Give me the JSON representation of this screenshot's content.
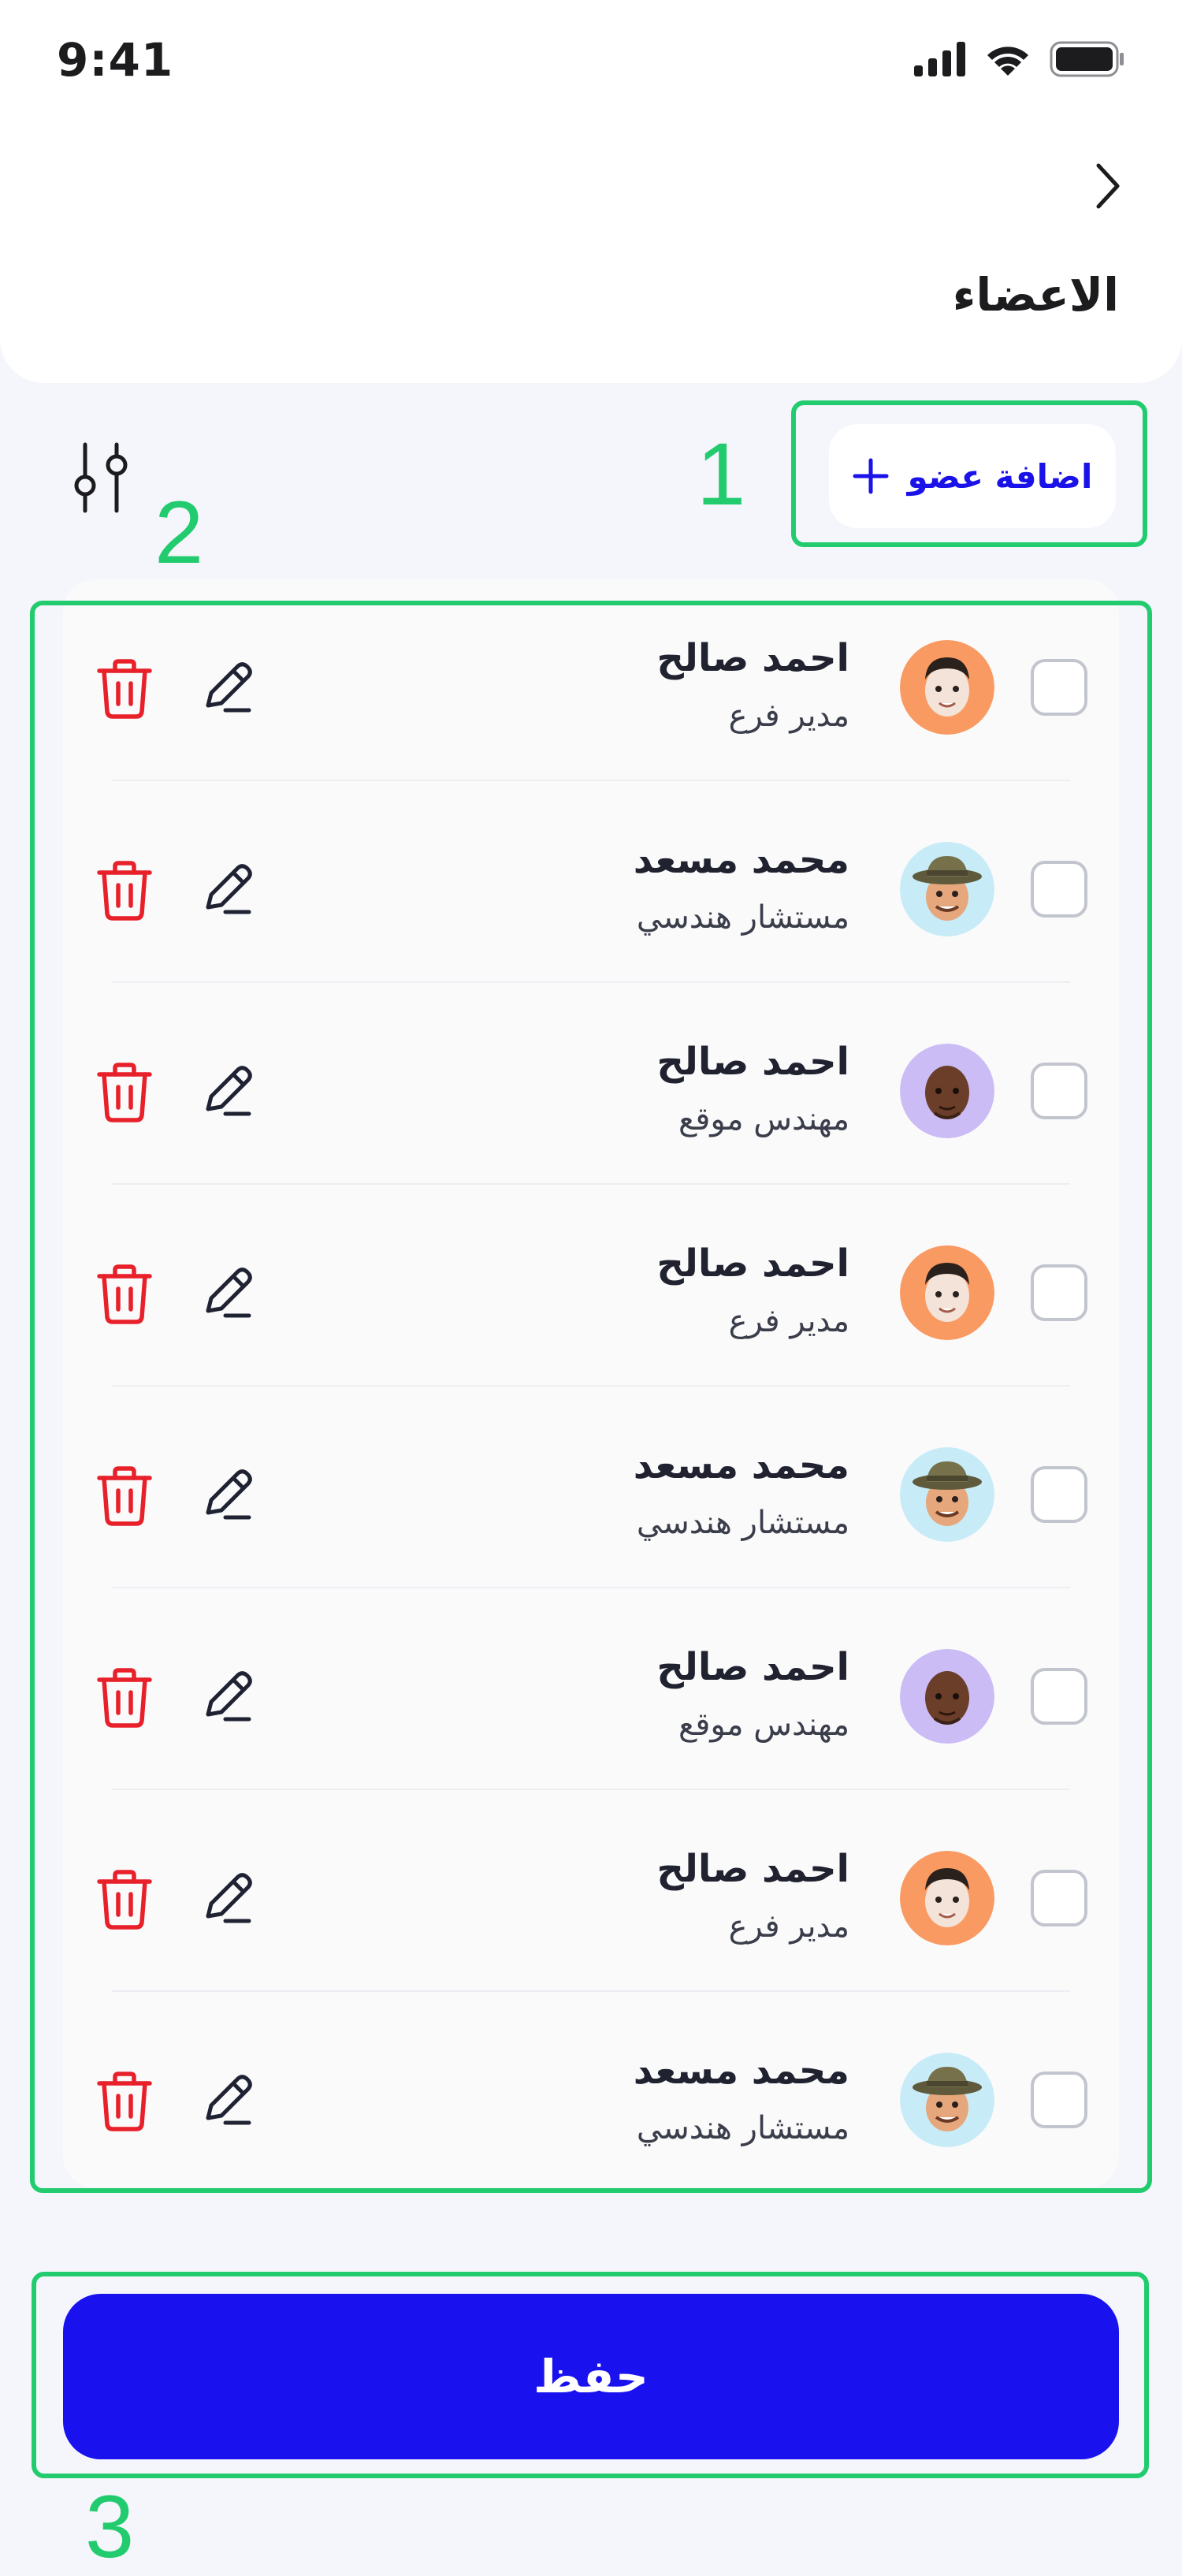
{
  "status_bar": {
    "time": "9:41"
  },
  "header": {
    "title": "الاعضاء"
  },
  "toolbar": {
    "add_member_label": "اضافة عضو"
  },
  "members": [
    {
      "name": "احمد صالح",
      "role": "مدير فرع",
      "avatar": "avatar-orange"
    },
    {
      "name": "محمد مسعد",
      "role": "مستشار هندسي",
      "avatar": "avatar-explorer"
    },
    {
      "name": "احمد صالح",
      "role": "مهندس موقع",
      "avatar": "avatar-purple"
    },
    {
      "name": "احمد صالح",
      "role": "مدير فرع",
      "avatar": "avatar-orange"
    },
    {
      "name": "محمد مسعد",
      "role": "مستشار هندسي",
      "avatar": "avatar-explorer"
    },
    {
      "name": "احمد صالح",
      "role": "مهندس موقع",
      "avatar": "avatar-purple"
    },
    {
      "name": "احمد صالح",
      "role": "مدير فرع",
      "avatar": "avatar-orange"
    },
    {
      "name": "محمد مسعد",
      "role": "مستشار هندسي",
      "avatar": "avatar-explorer"
    }
  ],
  "footer": {
    "save_label": "حفظ"
  },
  "annotations": [
    "1",
    "2",
    "3"
  ],
  "colors": {
    "accent": "#1a12ee",
    "delete": "#e8202a",
    "annotation": "#22cc6e"
  }
}
